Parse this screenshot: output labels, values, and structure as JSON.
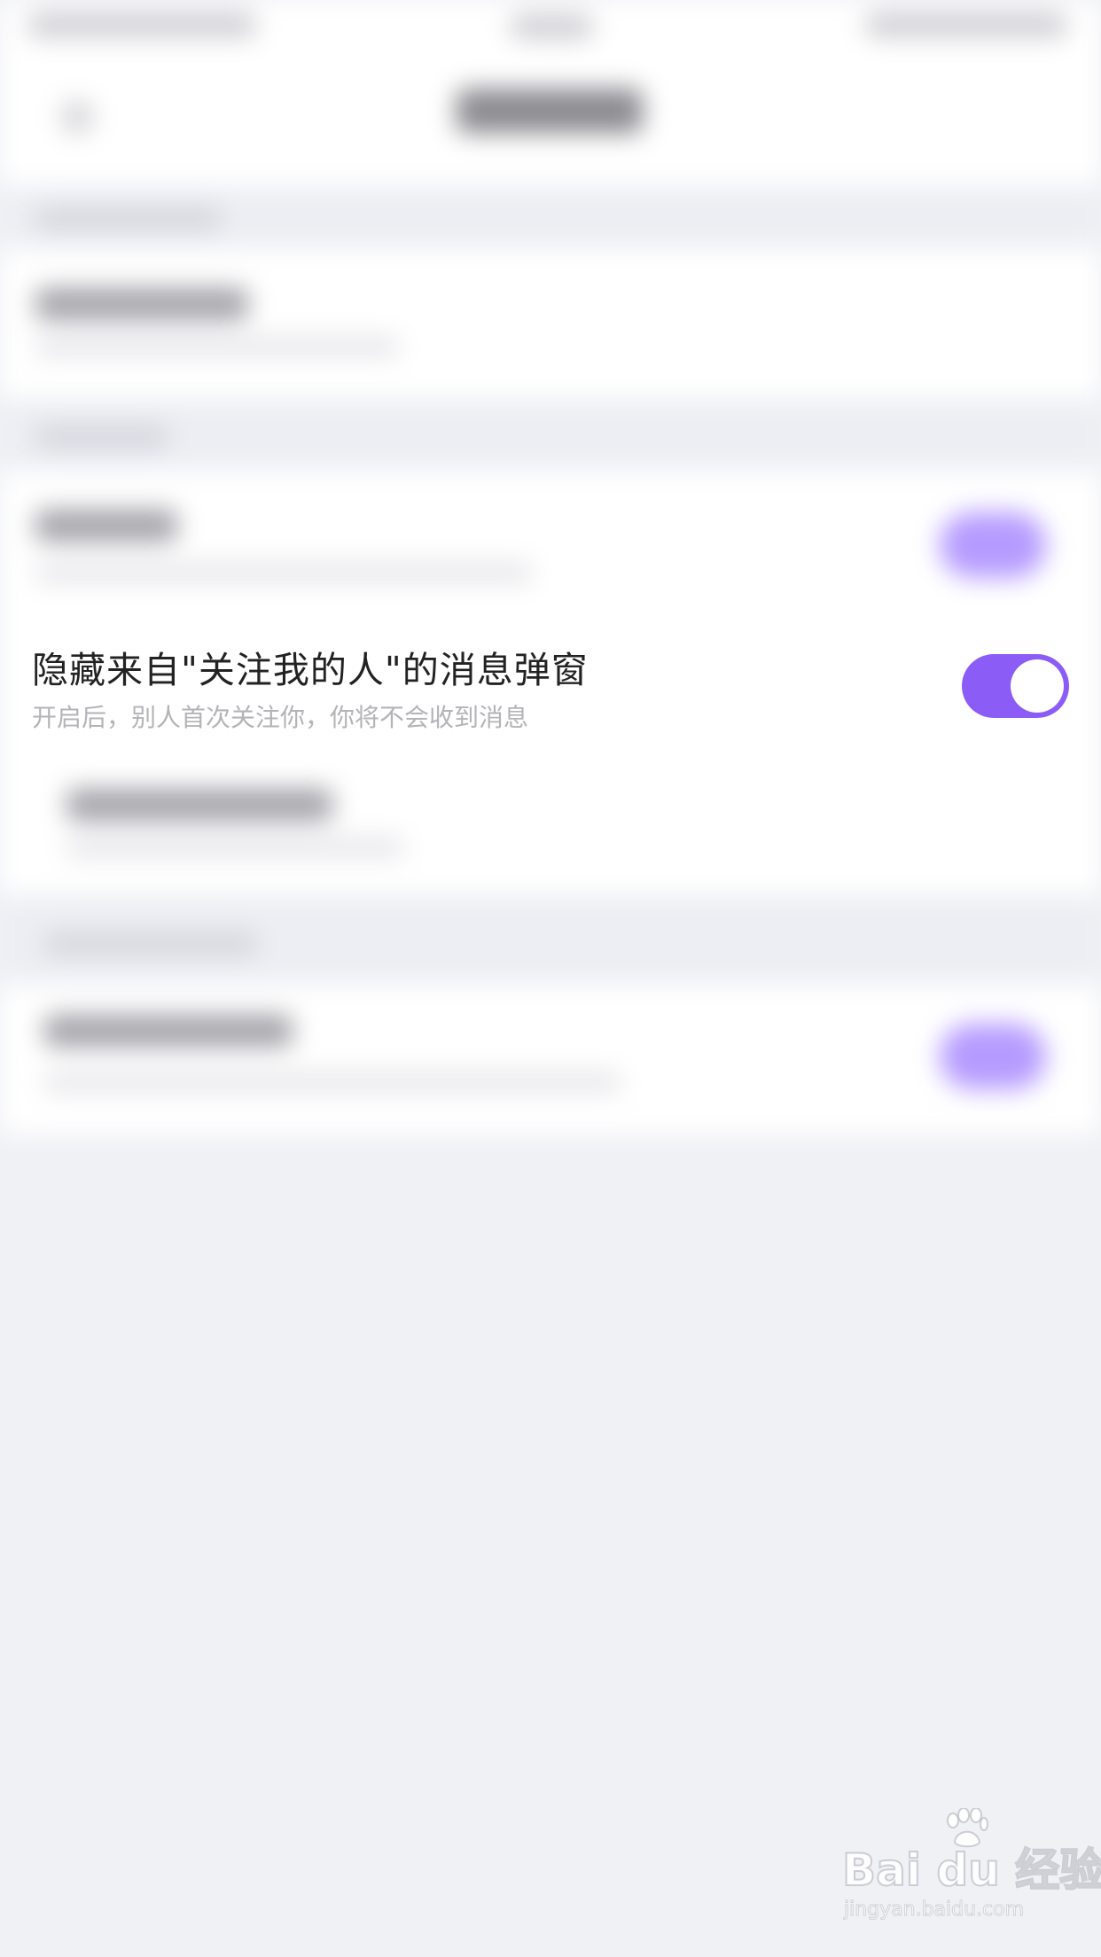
{
  "colors": {
    "accent": "#8b5cf6",
    "background": "#f0f1f5",
    "title_text": "#222222",
    "subtitle_text": "#b3b3b8"
  },
  "setting": {
    "title": "隐藏来自\"关注我的人\"的消息弹窗",
    "subtitle": "开启后，别人首次关注你，你将不会收到消息",
    "toggle_state": "on"
  },
  "watermark": {
    "logo_text": "Bai du 经验",
    "url": "jingyan.baidu.com",
    "paw_icon": "baidu-paw-icon"
  }
}
